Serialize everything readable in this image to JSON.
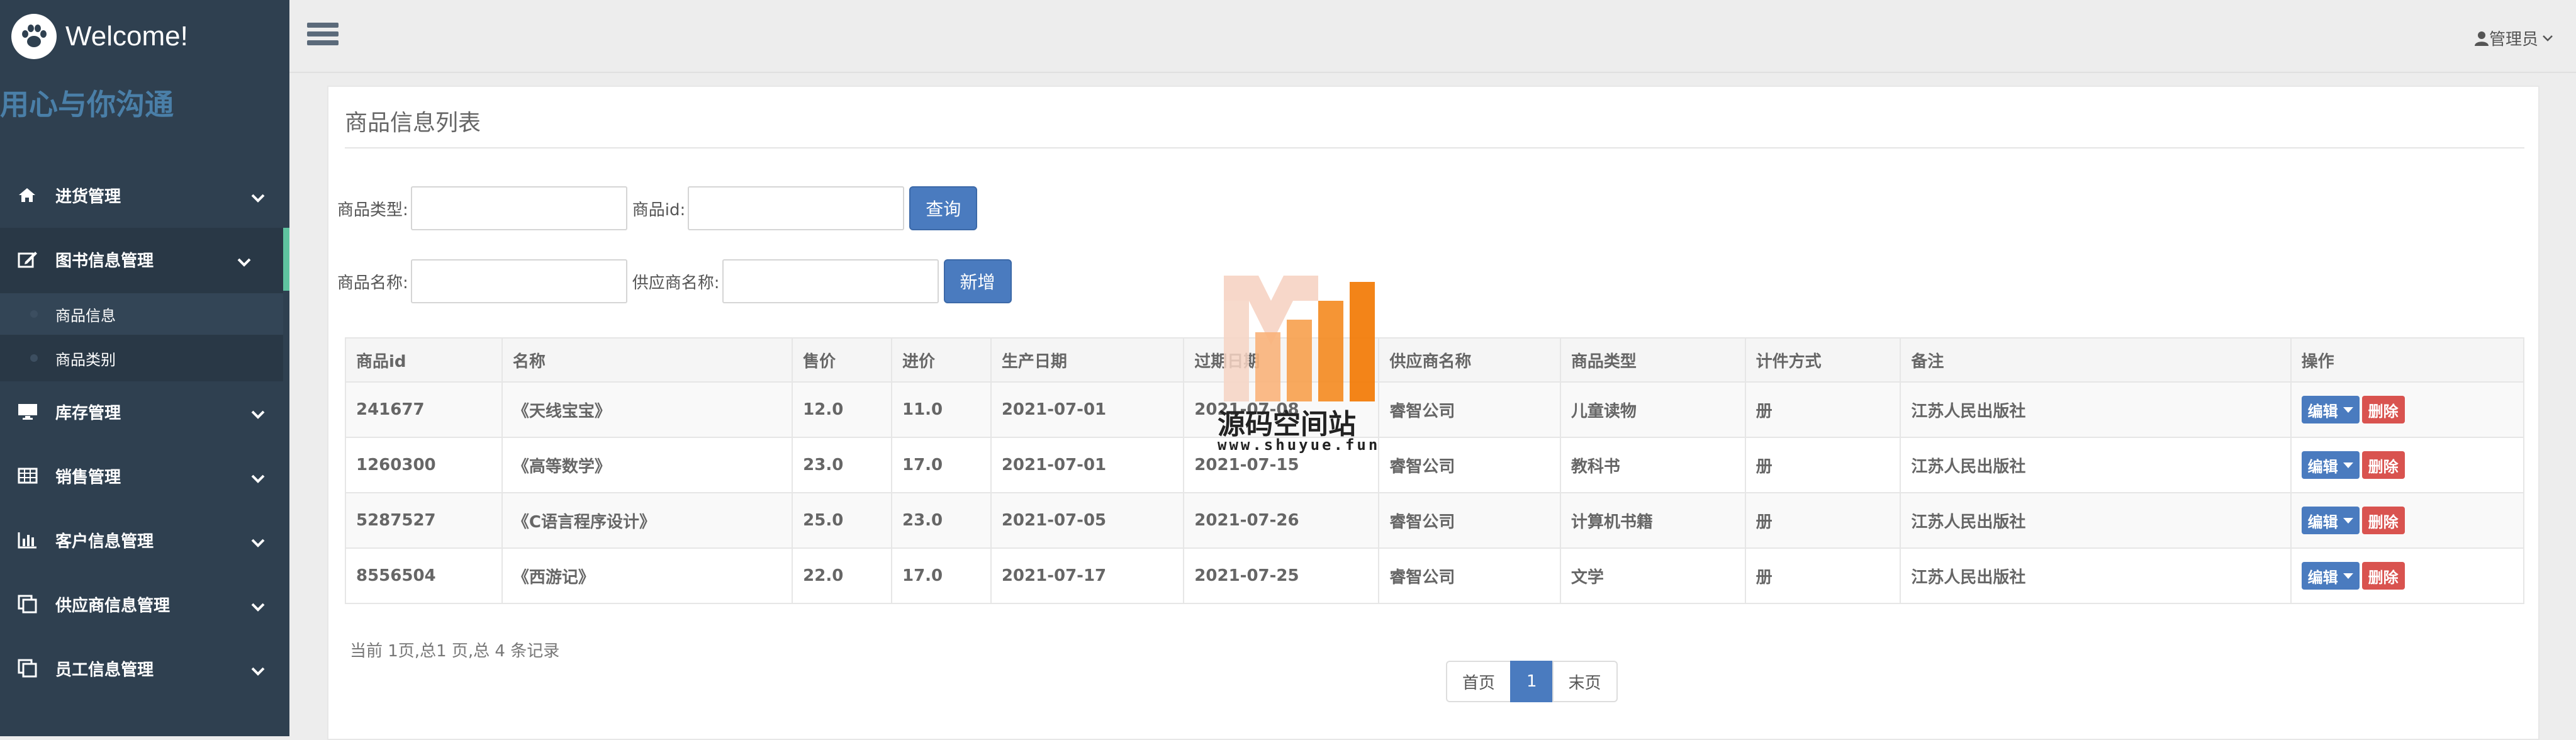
{
  "app": {
    "brand_title": "Welcome!",
    "motto": "用心与你沟通"
  },
  "sidebar": {
    "items": [
      {
        "label": "进货管理",
        "icon": "home-icon"
      },
      {
        "label": "图书信息管理",
        "icon": "edit-icon"
      },
      {
        "label": "库存管理",
        "icon": "monitor-icon"
      },
      {
        "label": "销售管理",
        "icon": "table-icon"
      },
      {
        "label": "客户信息管理",
        "icon": "bar-chart-icon"
      },
      {
        "label": "供应商信息管理",
        "icon": "copy-icon"
      },
      {
        "label": "员工信息管理",
        "icon": "copy-icon"
      }
    ],
    "subitems": [
      {
        "label": "商品信息"
      },
      {
        "label": "商品类别"
      }
    ]
  },
  "header": {
    "user_label": "管理员"
  },
  "panel": {
    "title": "商品信息列表"
  },
  "search": {
    "type_label": "商品类型:",
    "id_label": "商品id:",
    "query_button": "查询",
    "name_label": "商品名称:",
    "supplier_label": "供应商名称:",
    "add_button": "新增"
  },
  "table": {
    "columns": [
      "商品id",
      "名称",
      "售价",
      "进价",
      "生产日期",
      "过期日期",
      "供应商名称",
      "商品类型",
      "计件方式",
      "备注",
      "操作"
    ],
    "rows": [
      [
        "241677",
        "《天线宝宝》",
        "12.0",
        "11.0",
        "2021-07-01",
        "2021-07-08",
        "睿智公司",
        "儿童读物",
        "册",
        "江苏人民出版社"
      ],
      [
        "1260300",
        "《高等数学》",
        "23.0",
        "17.0",
        "2021-07-01",
        "2021-07-15",
        "睿智公司",
        "教科书",
        "册",
        "江苏人民出版社"
      ],
      [
        "5287527",
        "《C语言程序设计》",
        "25.0",
        "23.0",
        "2021-07-05",
        "2021-07-26",
        "睿智公司",
        "计算机书籍",
        "册",
        "江苏人民出版社"
      ],
      [
        "8556504",
        "《西游记》",
        "22.0",
        "17.0",
        "2021-07-17",
        "2021-07-25",
        "睿智公司",
        "文学",
        "册",
        "江苏人民出版社"
      ]
    ],
    "edit_label": "编辑",
    "delete_label": "删除"
  },
  "pagination": {
    "summary": "当前 1页,总1 页,总 4 条记录",
    "first": "首页",
    "current": "1",
    "last": "末页"
  },
  "watermark": {
    "text": "源码空间站",
    "url": "www.shuyue.fun"
  },
  "colors": {
    "sidebar_bg": "#2f4050",
    "accent": "#4a7bbf",
    "danger": "#d9534f",
    "active_marker": "#5fc4a0"
  }
}
